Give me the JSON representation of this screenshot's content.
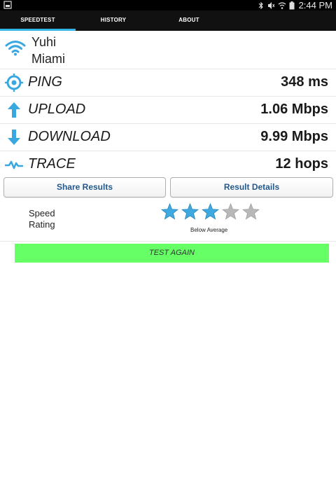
{
  "status_bar": {
    "time": "2:44 PM",
    "icons": [
      "screenshot-icon",
      "bluetooth-icon",
      "mute-icon",
      "wifi-icon",
      "battery-icon"
    ]
  },
  "tabs": [
    {
      "label": "SPEEDTEST",
      "active": true
    },
    {
      "label": "HISTORY",
      "active": false
    },
    {
      "label": "ABOUT",
      "active": false
    }
  ],
  "server": {
    "name": "Yuhi",
    "city": "Miami"
  },
  "metrics": {
    "ping": {
      "label": "PING",
      "value": "348 ms"
    },
    "upload": {
      "label": "UPLOAD",
      "value": "1.06 Mbps"
    },
    "download": {
      "label": "DOWNLOAD",
      "value": "9.99 Mbps"
    },
    "trace": {
      "label": "TRACE",
      "value": "12 hops"
    }
  },
  "buttons": {
    "share": "Share Results",
    "details": "Result Details",
    "test_again": "TEST AGAIN"
  },
  "rating": {
    "label_line1": "Speed",
    "label_line2": "Rating",
    "stars_filled": 3,
    "stars_total": 5,
    "text": "Below Average"
  },
  "colors": {
    "accent_blue": "#33b5e5",
    "star_filled": "#3fa9e0",
    "star_empty": "#b8b8b8",
    "test_again_bg": "#66ff66",
    "button_text": "#22588c"
  }
}
